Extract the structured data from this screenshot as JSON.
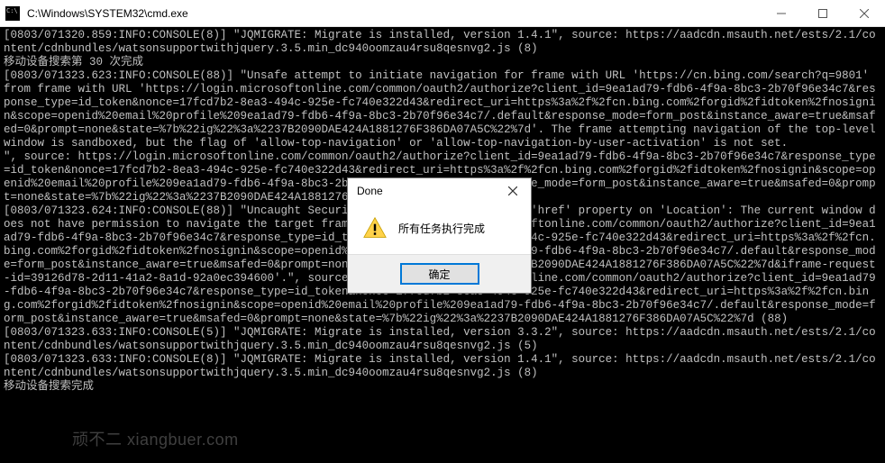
{
  "window": {
    "title": "C:\\Windows\\SYSTEM32\\cmd.exe"
  },
  "console": {
    "text": "[0803/071320.859:INFO:CONSOLE(8)] \"JQMIGRATE: Migrate is installed, version 1.4.1\", source: https://aadcdn.msauth.net/ests/2.1/content/cdnbundles/watsonsupportwithjquery.3.5.min_dc940oomzau4rsu8qesnvg2.js (8)\n移动设备搜索第 30 次完成\n[0803/071323.623:INFO:CONSOLE(88)] \"Unsafe attempt to initiate navigation for frame with URL 'https://cn.bing.com/search?q=9801' from frame with URL 'https://login.microsoftonline.com/common/oauth2/authorize?client_id=9ea1ad79-fdb6-4f9a-8bc3-2b70f96e34c7&response_type=id_token&nonce=17fcd7b2-8ea3-494c-925e-fc740e322d43&redirect_uri=https%3a%2f%2fcn.bing.com%2forgid%2fidtoken%2fnosignin&scope=openid%20email%20profile%209ea1ad79-fdb6-4f9a-8bc3-2b70f96e34c7/.default&response_mode=form_post&instance_aware=true&msafed=0&prompt=none&state=%7b%22ig%22%3a%2237B2090DAE424A1881276F386DA07A5C%22%7d'. The frame attempting navigation of the top-level window is sandboxed, but the flag of 'allow-top-navigation' or 'allow-top-navigation-by-user-activation' is not set.\n\", source: https://login.microsoftonline.com/common/oauth2/authorize?client_id=9ea1ad79-fdb6-4f9a-8bc3-2b70f96e34c7&response_type=id_token&nonce=17fcd7b2-8ea3-494c-925e-fc740e322d43&redirect_uri=https%3a%2f%2fcn.bing.com%2forgid%2fidtoken%2fnosignin&scope=openid%20email%20profile%209ea1ad79-fdb6-4f9a-8bc3-2b70f96e34c7/.default&response_mode=form_post&instance_aware=true&msafed=0&prompt=none&state=%7b%22ig%22%3a%2237B2090DAE424A1881276F386DA07A5C%22%7d (88)\n[0803/071323.624:INFO:CONSOLE(88)] \"Uncaught SecurityError: Failed to set the 'href' property on 'Location': The current window does not have permission to navigate the target frame to 'https://login.microsoftonline.com/common/oauth2/authorize?client_id=9ea1ad79-fdb6-4f9a-8bc3-2b70f96e34c7&response_type=id_token&nonce=17fcd7b2-8ea3-494c-925e-fc740e322d43&redirect_uri=https%3a%2f%2fcn.bing.com%2forgid%2fidtoken%2fnosignin&scope=openid%20email%20profile%209ea1ad79-fdb6-4f9a-8bc3-2b70f96e34c7/.default&response_mode=form_post&instance_aware=true&msafed=0&prompt=none&state=%7b%22ig%22%3a%2237B2090DAE424A1881276F386DA07A5C%22%7d&iframe-request-id=39126d78-2d11-41a2-8a1d-92a0ec394600'.\", source: https://login.microsoftonline.com/common/oauth2/authorize?client_id=9ea1ad79-fdb6-4f9a-8bc3-2b70f96e34c7&response_type=id_token&nonce=17fcd7b2-8ea3-494c-925e-fc740e322d43&redirect_uri=https%3a%2f%2fcn.bing.com%2forgid%2fidtoken%2fnosignin&scope=openid%20email%20profile%209ea1ad79-fdb6-4f9a-8bc3-2b70f96e34c7/.default&response_mode=form_post&instance_aware=true&msafed=0&prompt=none&state=%7b%22ig%22%3a%2237B2090DAE424A1881276F386DA07A5C%22%7d (88)\n[0803/071323.633:INFO:CONSOLE(5)] \"JQMIGRATE: Migrate is installed, version 3.3.2\", source: https://aadcdn.msauth.net/ests/2.1/content/cdnbundles/watsonsupportwithjquery.3.5.min_dc940oomzau4rsu8qesnvg2.js (5)\n[0803/071323.633:INFO:CONSOLE(8)] \"JQMIGRATE: Migrate is installed, version 1.4.1\", source: https://aadcdn.msauth.net/ests/2.1/content/cdnbundles/watsonsupportwithjquery.3.5.min_dc940oomzau4rsu8qesnvg2.js (8)\n移动设备搜索完成"
  },
  "dialog": {
    "title": "Done",
    "message": "所有任务执行完成",
    "ok_label": "确定"
  },
  "watermark": "顽不二 xiangbuer.com"
}
